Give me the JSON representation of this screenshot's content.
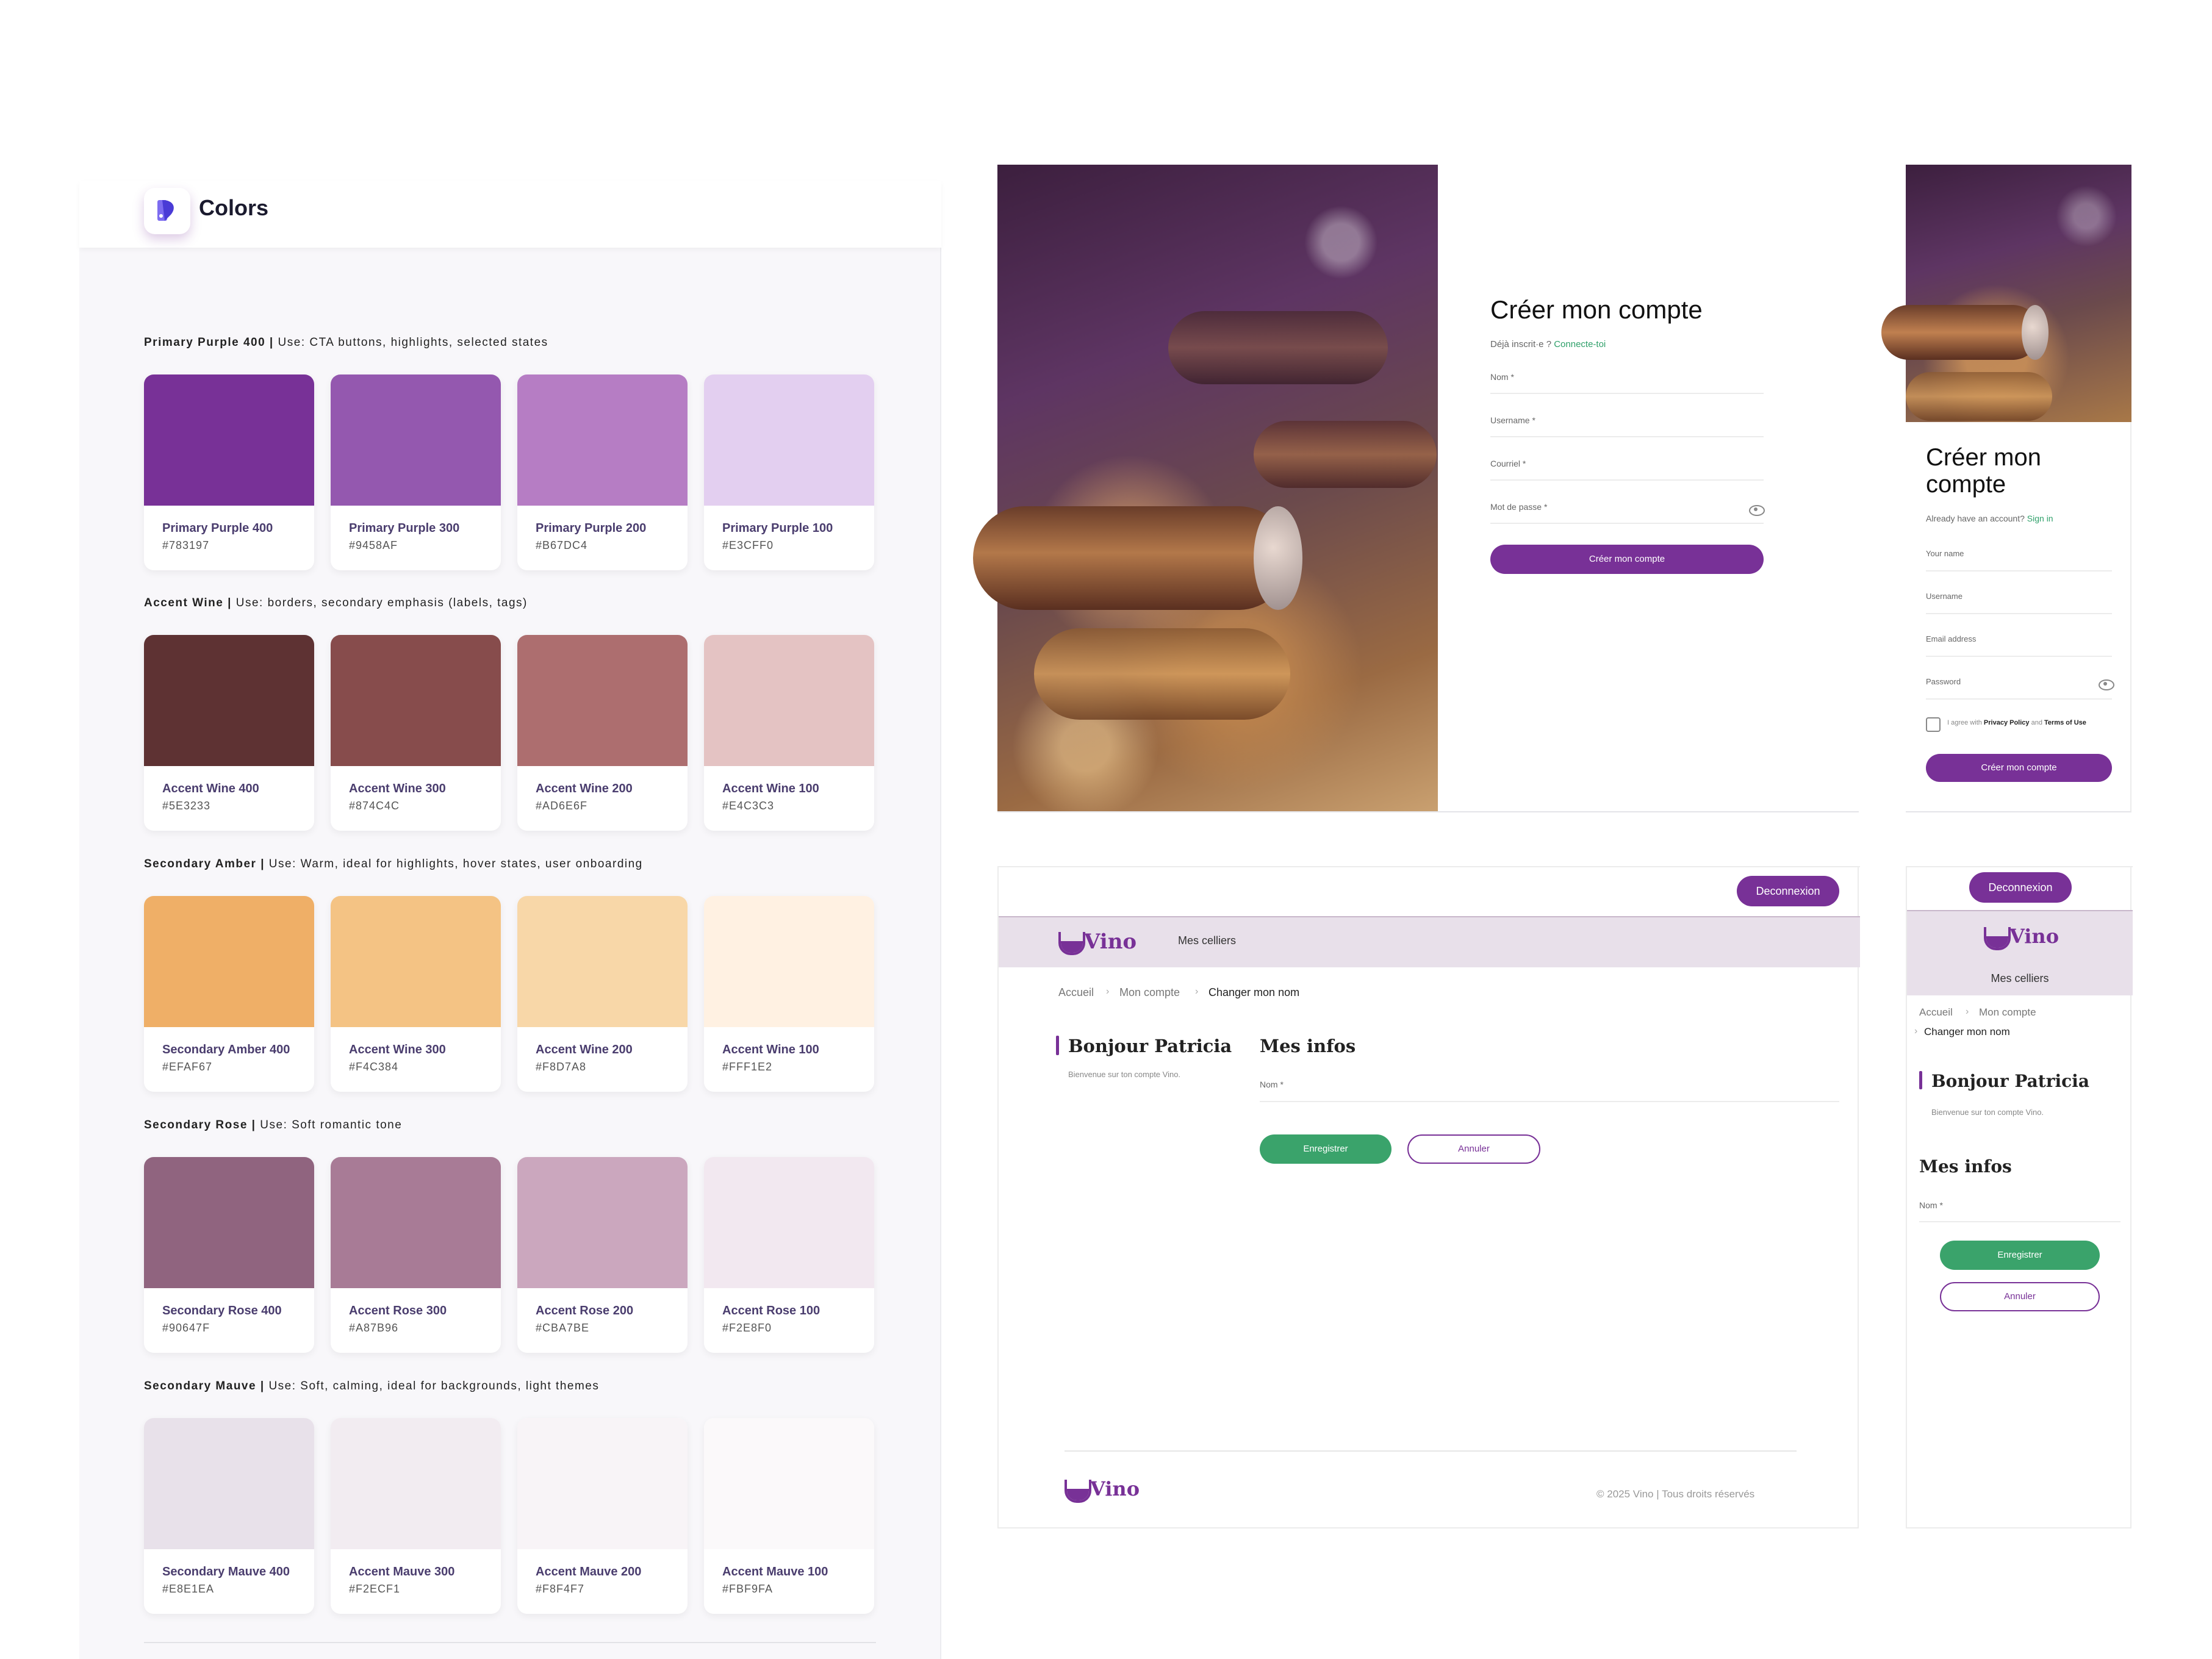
{
  "palette": {
    "title": "Colors",
    "sections": [
      {
        "name": "Primary Purple 400",
        "sep": " | ",
        "use": "Use: CTA buttons, highlights, selected states",
        "swatches": [
          {
            "name": "Primary Purple 400",
            "hex": "#783197",
            "color": "#783197"
          },
          {
            "name": "Primary Purple 300",
            "hex": "#9458AF",
            "color": "#9458AF"
          },
          {
            "name": "Primary Purple 200",
            "hex": "#B67DC4",
            "color": "#B67DC4"
          },
          {
            "name": "Primary Purple 100",
            "hex": "#E3CFF0",
            "color": "#E3CFF0"
          }
        ]
      },
      {
        "name": "Accent Wine",
        "sep": " | ",
        "use": "Use: borders, secondary emphasis (labels, tags)",
        "swatches": [
          {
            "name": "Accent Wine 400",
            "hex": "#5E3233",
            "color": "#5E3233"
          },
          {
            "name": "Accent Wine 300",
            "hex": "#874C4C",
            "color": "#874C4C"
          },
          {
            "name": "Accent Wine 200",
            "hex": "#AD6E6F",
            "color": "#AD6E6F"
          },
          {
            "name": "Accent Wine 100",
            "hex": "#E4C3C3",
            "color": "#E4C3C3"
          }
        ]
      },
      {
        "name": "Secondary Amber",
        "sep": " | ",
        "use": "Use: Warm, ideal for highlights, hover states, user onboarding",
        "swatches": [
          {
            "name": "Secondary Amber 400",
            "hex": "#EFAF67",
            "color": "#EFAF67"
          },
          {
            "name": "Accent Wine 300",
            "hex": "#F4C384",
            "color": "#F4C384"
          },
          {
            "name": "Accent Wine 200",
            "hex": "#F8D7A8",
            "color": "#F8D7A8"
          },
          {
            "name": "Accent Wine 100",
            "hex": "#FFF1E2",
            "color": "#FFF1E2"
          }
        ]
      },
      {
        "name": "Secondary Rose",
        "sep": " | ",
        "use": "Use: Soft romantic tone",
        "swatches": [
          {
            "name": "Secondary Rose 400",
            "hex": "#90647F",
            "color": "#90647F"
          },
          {
            "name": "Accent Rose 300",
            "hex": "#A87B96",
            "color": "#A87B96"
          },
          {
            "name": "Accent Rose 200",
            "hex": "#CBA7BE",
            "color": "#CBA7BE"
          },
          {
            "name": "Accent Rose 100",
            "hex": "#F2E8F0",
            "color": "#F2E8F0"
          }
        ]
      },
      {
        "name": "Secondary Mauve",
        "sep": " | ",
        "use": "Use: Soft, calming, ideal for backgrounds, light themes",
        "swatches": [
          {
            "name": "Secondary Mauve 400",
            "hex": "#E8E1EA",
            "color": "#E8E1EA"
          },
          {
            "name": "Accent Mauve 300",
            "hex": "#F2ECF1",
            "color": "#F2ECF1"
          },
          {
            "name": "Accent Mauve 200",
            "hex": "#F8F4F7",
            "color": "#F8F4F7"
          },
          {
            "name": "Accent Mauve 100",
            "hex": "#FBF9FA",
            "color": "#FBF9FA"
          }
        ]
      }
    ]
  },
  "signup_desktop": {
    "title": "Créer mon compte",
    "login_prompt": "Déjà inscrit·e ? ",
    "login_link": "Connecte-toi",
    "fields": [
      "Nom *",
      "Username *",
      "Courriel *",
      "Mot de passe *"
    ],
    "submit": "Créer mon compte"
  },
  "signup_mobile": {
    "title": "Créer mon compte",
    "login_prompt": "Already have an account? ",
    "login_link": "Sign in",
    "fields": [
      "Your name",
      "Username",
      "Email address",
      "Password"
    ],
    "agree_prefix": "I agree with ",
    "agree_privacy": "Privacy Policy",
    "agree_and": " and ",
    "agree_terms": "Terms of Use",
    "submit": "Créer mon compte"
  },
  "account_desktop": {
    "logout": "Deconnexion",
    "brand": "Vino",
    "nav_celliers": "Mes celliers",
    "breadcrumb": [
      "Accueil",
      "Mon compte",
      "Changer mon nom"
    ],
    "greeting": "Bonjour Patricia",
    "welcome": "Bienvenue sur ton compte Vino.",
    "section_title": "Mes infos",
    "field": "Nom *",
    "save": "Enregistrer",
    "cancel": "Annuler",
    "footer_brand": "Vino",
    "copyright": "© 2025 Vino | Tous droits réservés"
  },
  "account_mobile": {
    "logout": "Deconnexion",
    "brand": "Vino",
    "nav_celliers": "Mes celliers",
    "breadcrumb": [
      "Accueil",
      "Mon compte",
      "Changer mon nom"
    ],
    "greeting": "Bonjour Patricia",
    "welcome": "Bienvenue sur ton compte Vino.",
    "section_title": "Mes infos",
    "field": "Nom *",
    "save": "Enregistrer",
    "cancel": "Annuler"
  },
  "colors": {
    "primary": "#783197",
    "success": "#3AA36B",
    "nav_bg": "#E8E0EA"
  }
}
